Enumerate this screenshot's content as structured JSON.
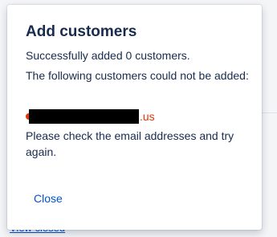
{
  "background": {
    "link_label": "View closed"
  },
  "dialog": {
    "title": "Add customers",
    "success_message": "Successfully added 0 customers.",
    "failed_heading": "The following customers could not be added:",
    "failed_customers": [
      {
        "email_visible_suffix": ".us",
        "redacted": true
      }
    ],
    "help_message": "Please check the email addresses and try again.",
    "close_label": "Close"
  },
  "colors": {
    "text": "#172b4d",
    "link": "#0052cc",
    "error": "#de350b"
  }
}
